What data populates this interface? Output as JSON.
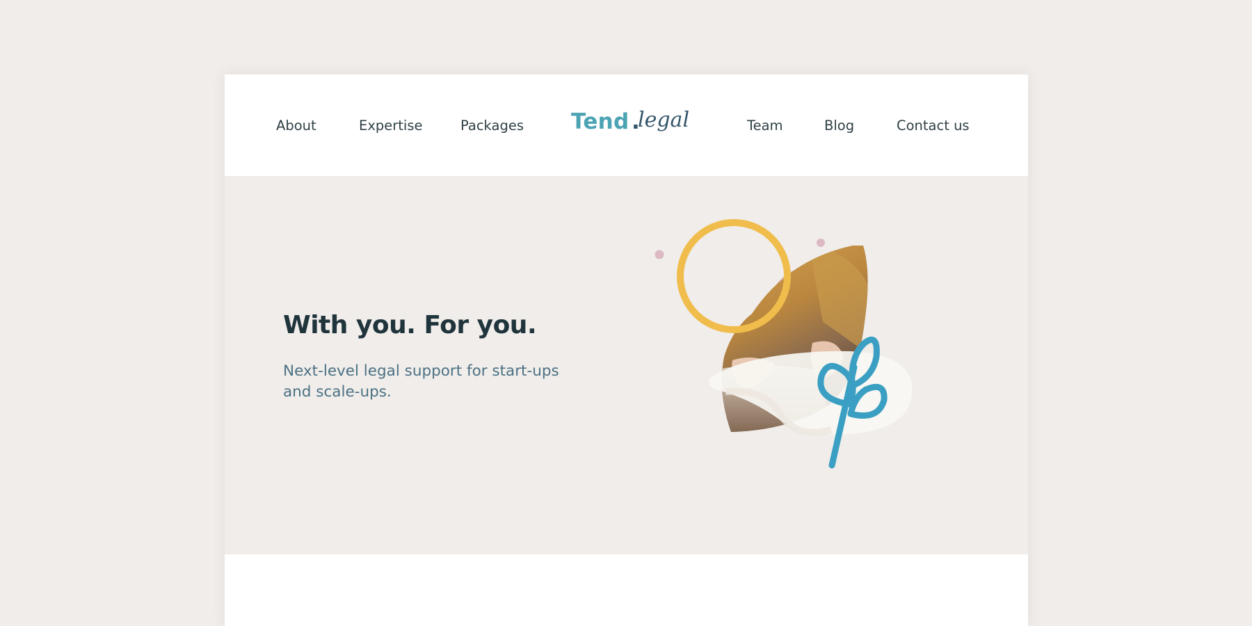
{
  "nav": {
    "left_items": [
      {
        "label": "About"
      },
      {
        "label": "Expertise"
      },
      {
        "label": "Packages"
      }
    ],
    "right_items": [
      {
        "label": "Team"
      },
      {
        "label": "Blog"
      },
      {
        "label": "Contact us"
      }
    ]
  },
  "logo": {
    "main": "Tend",
    "dot": ".",
    "script": "legal"
  },
  "hero": {
    "title": "With you. For you.",
    "subtitle": "Next-level legal support for start-ups and scale-ups."
  },
  "colors": {
    "background": "#f0edea",
    "brand_teal": "#4ba3b3",
    "brand_navy": "#34566a",
    "title_text": "#20343c",
    "subtitle_text": "#4b7184",
    "nav_text": "#2f3f45",
    "accent_yellow": "#f0bc4c",
    "accent_blue": "#3a9fc2",
    "accent_pink": "#dcbac4"
  }
}
